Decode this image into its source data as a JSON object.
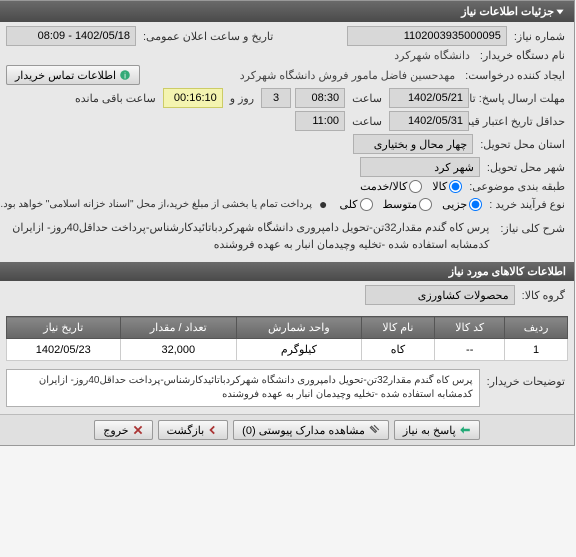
{
  "header": {
    "title": "جزئیات اطلاعات نیاز"
  },
  "info": {
    "needNoLabel": "شماره نیاز:",
    "needNo": "1102003935000095",
    "announceLabel": "تاریخ و ساعت اعلان عمومی:",
    "announceValue": "1402/05/18 - 08:09",
    "buyerNameLabel": "نام دستگاه خریدار:",
    "buyerName": "دانشگاه شهرکرد",
    "requesterLabel": "ایجاد کننده درخواست:",
    "requester": "مهدحسین فاضل مامور فروش دانشگاه شهرکرد",
    "contactBtn": "اطلاعات تماس خریدار",
    "replyDeadlineLabel": "مهلت ارسال پاسخ: تا تاریخ:",
    "date1": "1402/05/21",
    "time1": "08:30",
    "days": "3",
    "daysLabel": "روز و",
    "remain": "00:16:10",
    "remainLabel": "ساعت باقی مانده",
    "saatLabel": "ساعت",
    "creditDeadlineLabel": "حداقل تاریخ اعتبار قیمت تا تاریخ:",
    "date2": "1402/05/31",
    "time2": "11:00",
    "deliveryLocLabel": "استان محل تحویل:",
    "deliveryLoc": "چهار محال و بختیاری",
    "deliveryCityLabel": "شهر محل تحویل:",
    "deliveryCity": "شهر کرد",
    "budgetLabel": "طبقه بندی موضوعی:",
    "goods": "کالا",
    "service": "کالا/خدمت",
    "processLabel": "نوع فرآیند خرید :",
    "process1": "جزیی",
    "process2": "متوسط",
    "process3": "کلی",
    "note": "پرداخت تمام یا بخشی از مبلغ خرید،از محل \"اسناد خزانه اسلامی\" خواهد بود.",
    "paymentDot": "●"
  },
  "summary": {
    "label": "شرح کلی نیاز:",
    "text": "پرس کاه گندم مقدار32تن-تحویل دامپروری دانشگاه شهرکردباتائیدکارشناس-پرداخت حداقل40روز- ازایران کدمشابه استفاده شده -تخلیه وچیدمان انبار به عهده فروشنده"
  },
  "itemsHeader": "اطلاعات کالاهای مورد نیاز",
  "groupLabel": "گروه کالا:",
  "groupValue": "محصولات کشاورزی",
  "table": {
    "headers": [
      "ردیف",
      "کد کالا",
      "نام کالا",
      "واحد شمارش",
      "تعداد / مقدار",
      "تاریخ نیاز"
    ],
    "row": [
      "1",
      "--",
      "کاه",
      "کیلوگرم",
      "32,000",
      "1402/05/23"
    ]
  },
  "buyerNotes": {
    "label": "توضیحات خریدار:",
    "text": "پرس کاه گندم مقدار32تن-تحویل دامپروری دانشگاه شهرکردباتائیدکارشناس-پرداخت حداقل40روز- ازایران کدمشابه استفاده شده -تخلیه وچیدمان انبار به عهده فروشنده"
  },
  "footer": {
    "reply": "پاسخ به نیاز",
    "attach": "مشاهده مدارک پیوستی (0)",
    "back": "بازگشت",
    "exit": "خروج"
  }
}
